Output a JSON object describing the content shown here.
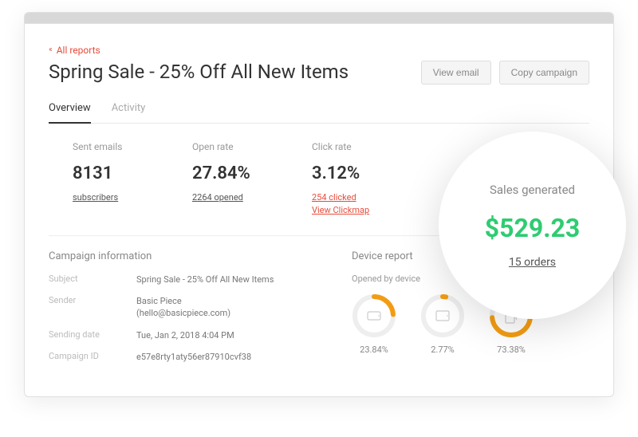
{
  "nav": {
    "back": "All reports"
  },
  "header": {
    "title": "Spring Sale - 25% Off All New Items",
    "view_email": "View email",
    "copy_campaign": "Copy campaign"
  },
  "tabs": {
    "overview": "Overview",
    "activity": "Activity"
  },
  "stats": {
    "sent": {
      "label": "Sent emails",
      "value": "8131",
      "sub": "subscribers"
    },
    "open": {
      "label": "Open rate",
      "value": "27.84%",
      "sub": "2264 opened"
    },
    "click": {
      "label": "Click rate",
      "value": "3.12%",
      "sub1": "254 clicked",
      "sub2": "View Clickmap"
    }
  },
  "sales_bubble": {
    "label": "Sales generated",
    "value": "$529.23",
    "sub": "15 orders"
  },
  "campaign_info": {
    "title": "Campaign information",
    "subject": {
      "key": "Subject",
      "val": "Spring Sale - 25% Off All New Items"
    },
    "sender": {
      "key": "Sender",
      "val": "Basic Piece",
      "val2": "(hello@basicpiece.com)"
    },
    "sending_date": {
      "key": "Sending date",
      "val": "Tue, Jan 2, 2018 4:04 PM"
    },
    "campaign_id": {
      "key": "Campaign ID",
      "val": "e57e8rty1aty56er87910cvf38"
    }
  },
  "device_report": {
    "title": "Device report",
    "subtitle": "Opened by device",
    "devices": [
      {
        "pct": "23.84%",
        "frac": 0.2384,
        "icon": "phone"
      },
      {
        "pct": "2.77%",
        "frac": 0.0277,
        "icon": "tablet"
      },
      {
        "pct": "73.38%",
        "frac": 0.7338,
        "icon": "desktop"
      }
    ]
  },
  "colors": {
    "accent_orange": "#f39c12",
    "accent_green": "#2ecc71",
    "accent_red": "#e74c3c"
  }
}
